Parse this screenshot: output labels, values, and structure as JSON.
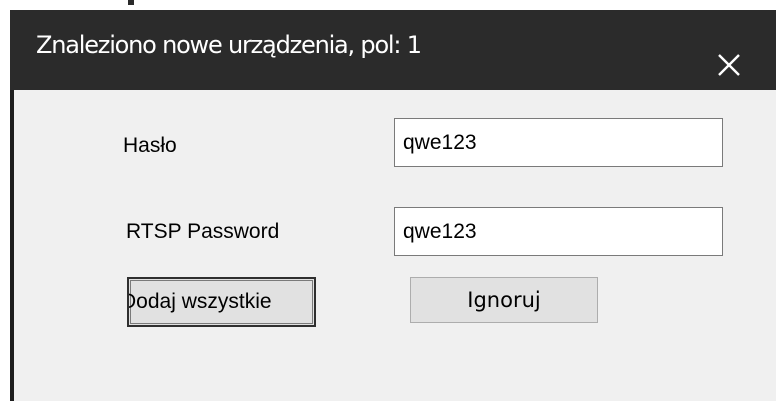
{
  "dialog": {
    "title": "Znaleziono nowe urządzenia, pol: 1",
    "close_icon": "close-icon"
  },
  "form": {
    "password_label": "Hasło",
    "password_value": "qwe123",
    "rtsp_label": "RTSP Password",
    "rtsp_value": "qwe123"
  },
  "buttons": {
    "add_all": "Dodaj wszystkie",
    "ignore": "Ignoruj"
  },
  "colors": {
    "title_bar": "#2b2b2b",
    "dialog_bg": "#f0f0f0",
    "button_bg": "#e1e1e1"
  }
}
